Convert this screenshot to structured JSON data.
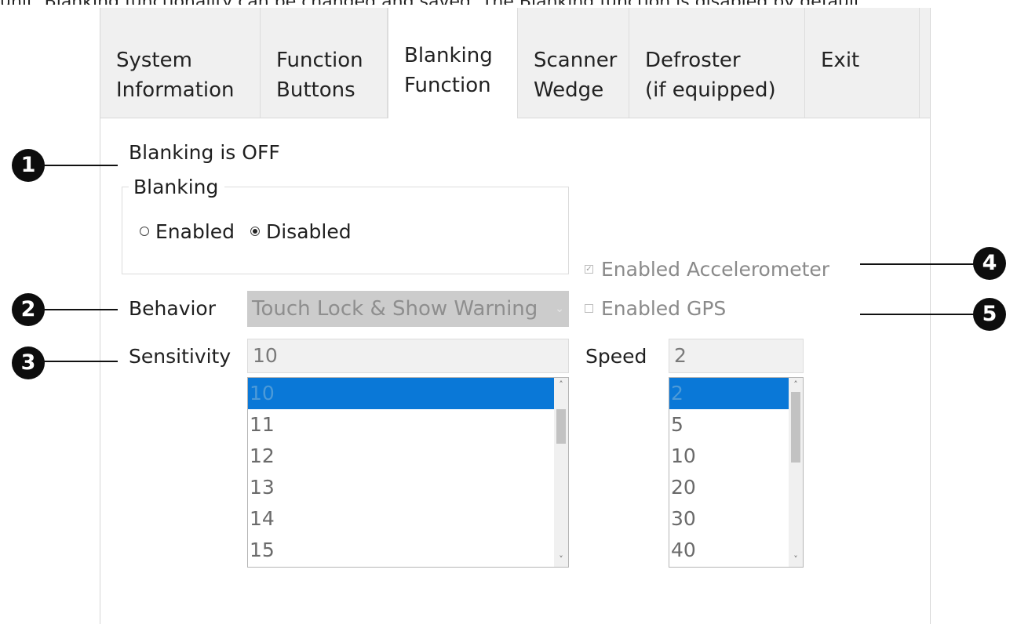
{
  "top_text": "unit, Blanking functionality can be changed and saved. The Blanking function is disabled by default.",
  "tabs": [
    {
      "line1": "System",
      "line2": "Information"
    },
    {
      "line1": "Function",
      "line2": "Buttons"
    },
    {
      "line1": "Blanking",
      "line2": "Function"
    },
    {
      "line1": "Scanner",
      "line2": "Wedge"
    },
    {
      "line1": "Defroster",
      "line2": "(if equipped)"
    },
    {
      "line1": "Exit",
      "line2": ""
    }
  ],
  "status_text": "Blanking is OFF",
  "blanking_group": {
    "title": "Blanking",
    "enabled_label": "Enabled",
    "disabled_label": "Disabled",
    "selected": "Disabled"
  },
  "behavior": {
    "label": "Behavior",
    "value": "Touch Lock & Show Warning"
  },
  "accelerometer": {
    "label": "Enabled Accelerometer",
    "checked": true
  },
  "gps": {
    "label": "Enabled GPS",
    "checked": false
  },
  "sensitivity": {
    "label": "Sensitivity",
    "value": "10",
    "options": [
      "10",
      "11",
      "12",
      "13",
      "14",
      "15"
    ]
  },
  "speed": {
    "label": "Speed",
    "value": "2",
    "options": [
      "2",
      "5",
      "10",
      "20",
      "30",
      "40"
    ]
  },
  "callouts": [
    "1",
    "2",
    "3",
    "4",
    "5"
  ],
  "colors": {
    "selection": "#0a78d7",
    "callout": "#0d0d0d"
  }
}
